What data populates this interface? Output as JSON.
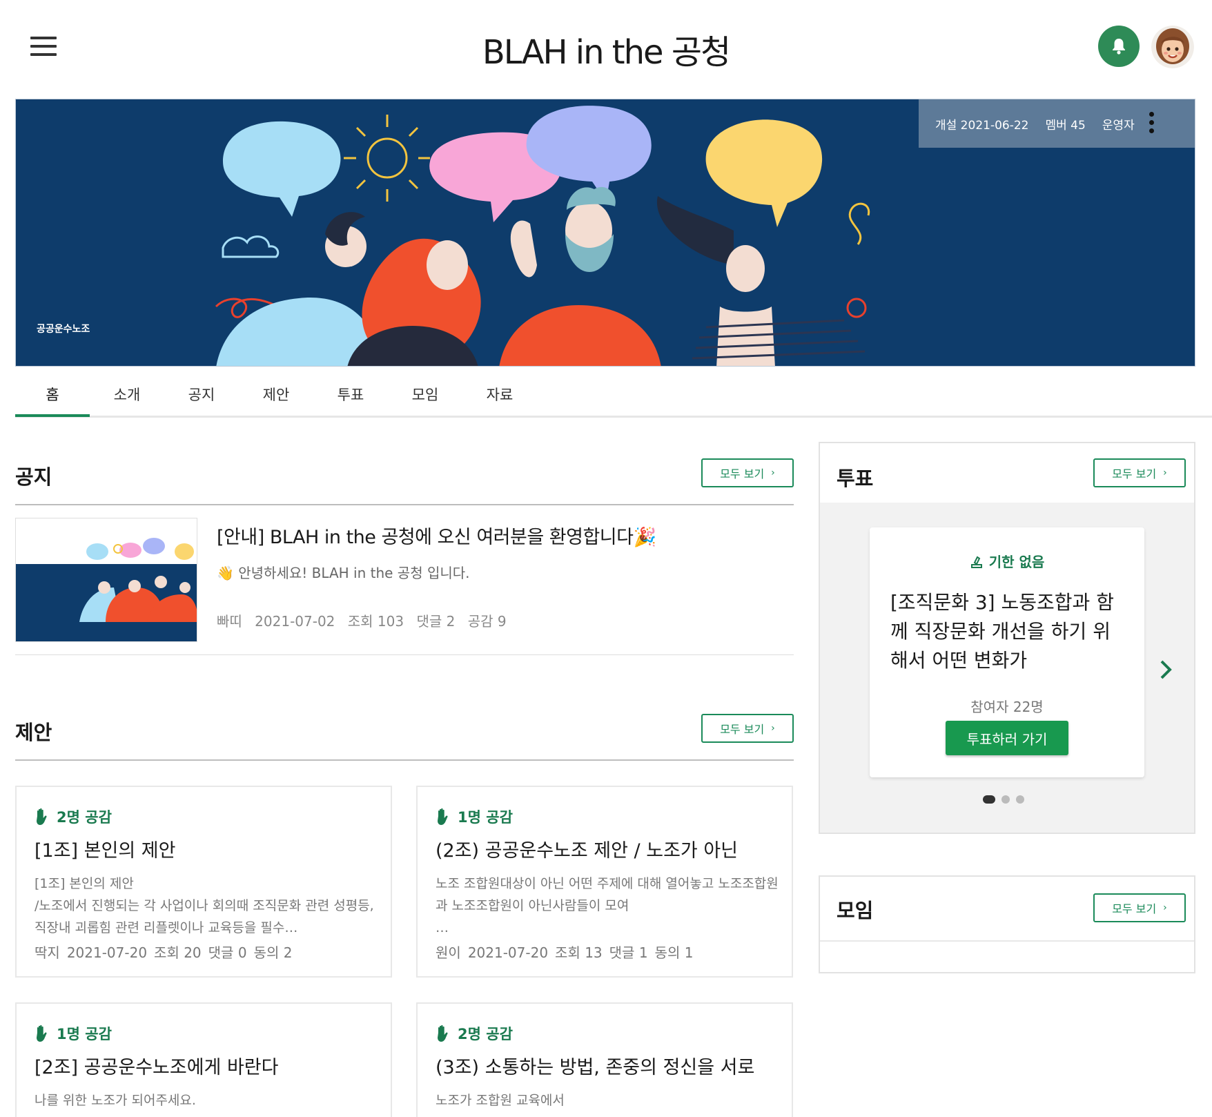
{
  "header": {
    "title": "BLAH in the 공청"
  },
  "banner": {
    "founded": "개설 2021-06-22",
    "members": "멤버 45",
    "admin": "운영자",
    "logo_text": "공공운수노조"
  },
  "tabs": [
    "홈",
    "소개",
    "공지",
    "제안",
    "투표",
    "모임",
    "자료"
  ],
  "notice": {
    "section_title": "공지",
    "more_label": "모두 보기",
    "item": {
      "title": "[안내] BLAH in the 공청에 오신 여러분을 환영합니다🎉",
      "desc": "👋 안녕하세요! BLAH in the 공청 입니다.",
      "author": "빠띠",
      "date": "2021-07-02",
      "views": "조회 103",
      "comments": "댓글 2",
      "likes": "공감 9"
    }
  },
  "proposals": {
    "section_title": "제안",
    "more_label": "모두 보기",
    "cards": [
      {
        "likes": "2명 공감",
        "title": "[1조] 본인의 제안",
        "body": "[1조] 본인의 제안\n/노조에서 진행되는 각 사업이나 회의때 조직문화 관련 성평등, 직장내 괴롭힘 관련 리플렛이나 교육등을 필수…",
        "author": "딱지",
        "date": "2021-07-20",
        "views": "조회 20",
        "comments": "댓글 0",
        "agree": "동의 2"
      },
      {
        "likes": "1명 공감",
        "title": "(2조) 공공운수노조 제안 / 노조가 아닌",
        "body": "노조 조합원대상이 아닌 어떤 주제에 대해 열어놓고 노조조합원과 노조조합원이 아닌사람들이 모여\n…",
        "author": "원이",
        "date": "2021-07-20",
        "views": "조회 13",
        "comments": "댓글 1",
        "agree": "동의 1"
      },
      {
        "likes": "1명 공감",
        "title": "[2조] 공공운수노조에게 바란다",
        "body": "나를 위한 노조가 되어주세요.",
        "author": "",
        "date": "",
        "views": "",
        "comments": "",
        "agree": ""
      },
      {
        "likes": "2명 공감",
        "title": "(3조) 소통하는 방법, 존중의 정신을 서로",
        "body": "노조가 조합원 교육에서",
        "author": "",
        "date": "",
        "views": "",
        "comments": "",
        "agree": ""
      }
    ]
  },
  "vote": {
    "section_title": "투표",
    "more_label": "모두 보기",
    "deadline": "기한 없음",
    "title": "[조직문화 3] 노동조합과 함께 직장문화 개선을 하기 위해서 어떤 변화가",
    "participants": "참여자 22명",
    "button": "투표하러 가기",
    "page_count": 3,
    "current_page": 1
  },
  "meeting": {
    "section_title": "모임",
    "more_label": "모두 보기"
  },
  "colors": {
    "accent": "#1a8a59",
    "banner_bg": "#0e3c6b",
    "bell_bg": "#2e8b57",
    "vote_button": "#18994f"
  },
  "icons": [
    "hamburger-menu-icon",
    "bell-icon",
    "avatar",
    "kebab-menu-icon",
    "chevron-right-icon",
    "hand-icon",
    "ballot-icon"
  ]
}
